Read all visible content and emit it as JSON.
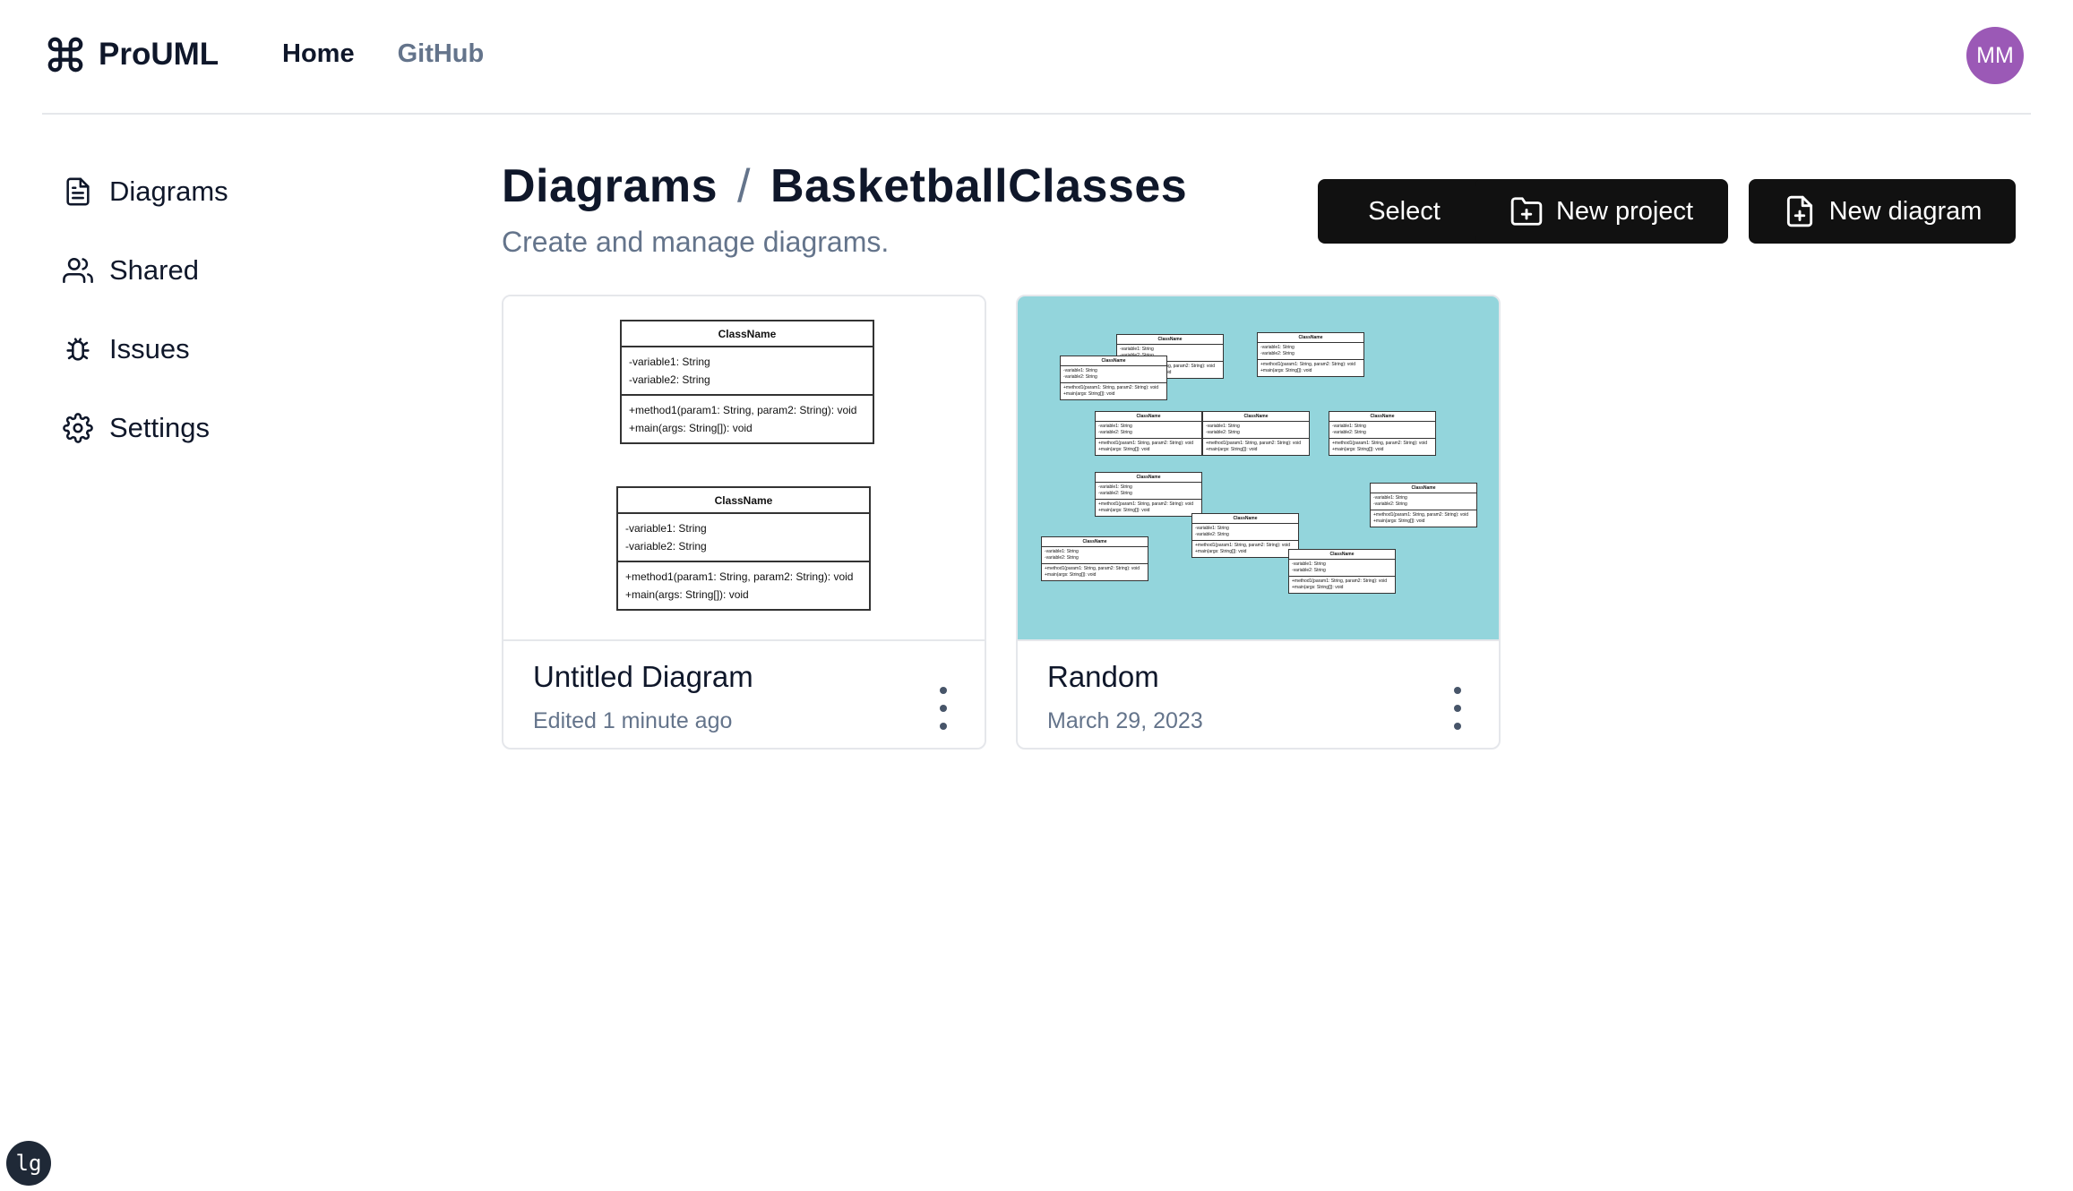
{
  "app": {
    "name": "ProUML",
    "logo_icon": "command-icon"
  },
  "nav": {
    "home": "Home",
    "github": "GitHub"
  },
  "user": {
    "initials": "MM",
    "avatar_color": "#9b59b6"
  },
  "sidebar": {
    "items": [
      {
        "label": "Diagrams",
        "icon": "file-text-icon"
      },
      {
        "label": "Shared",
        "icon": "users-icon"
      },
      {
        "label": "Issues",
        "icon": "bug-icon"
      },
      {
        "label": "Settings",
        "icon": "gear-icon"
      }
    ]
  },
  "page": {
    "breadcrumb_root": "Diagrams",
    "breadcrumb_sep": "/",
    "breadcrumb_current": "BasketballClasses",
    "subtitle": "Create and manage diagrams."
  },
  "actions": {
    "select": "Select",
    "new_project": "New project",
    "new_diagram": "New diagram"
  },
  "cards": [
    {
      "name": "Untitled Diagram",
      "meta": "Edited 1 minute ago",
      "thumb_bg": "#ffffff"
    },
    {
      "name": "Random",
      "meta": "March 29, 2023",
      "thumb_bg": "#93d5dc"
    }
  ],
  "uml": {
    "class_name": "ClassName",
    "var1": "-variable1: String",
    "var2": "-variable2: String",
    "method1": "+method1(param1: String, param2: String): void",
    "main": "+main(args: String[]): void"
  },
  "badge": "lg"
}
